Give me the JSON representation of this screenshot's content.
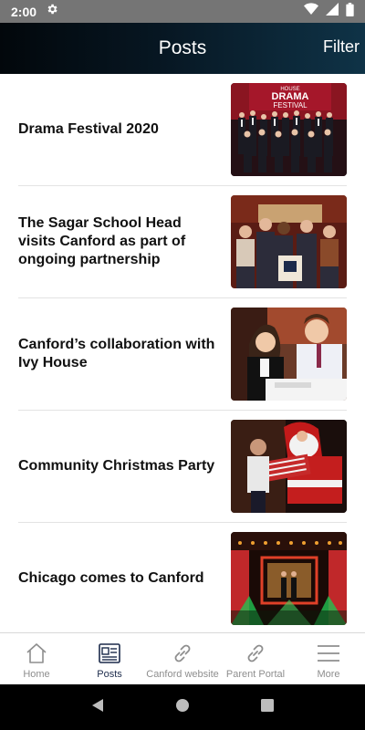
{
  "status_bar": {
    "time": "2:00"
  },
  "header": {
    "title": "Posts",
    "filter_label": "Filter"
  },
  "posts": [
    {
      "title": "Drama Festival 2020",
      "image": "drama-festival-photo"
    },
    {
      "title": "The Sagar School Head visits Canford as part of ongoing partnership",
      "image": "school-visit-photo"
    },
    {
      "title": "Canford’s collaboration with Ivy House",
      "image": "classroom-photo"
    },
    {
      "title": "Community Christmas Party",
      "image": "santa-photo"
    },
    {
      "title": "Chicago comes to Canford",
      "image": "stage-show-photo"
    }
  ],
  "drama_banner": {
    "line1": "HOUSE",
    "line2": "DRAMA",
    "line3": "FESTIVAL"
  },
  "bottom_nav": [
    {
      "label": "Home",
      "icon": "home-icon",
      "active": false
    },
    {
      "label": "Posts",
      "icon": "newspaper-icon",
      "active": true
    },
    {
      "label": "Canford website",
      "icon": "link-icon",
      "active": false
    },
    {
      "label": "Parent Portal",
      "icon": "link-icon",
      "active": false
    },
    {
      "label": "More",
      "icon": "menu-icon",
      "active": false
    }
  ],
  "colors": {
    "header_dark": "#02070b",
    "header_light": "#0f3347",
    "nav_active": "#1b2a4a",
    "nav_inactive": "#8e8e8e"
  }
}
